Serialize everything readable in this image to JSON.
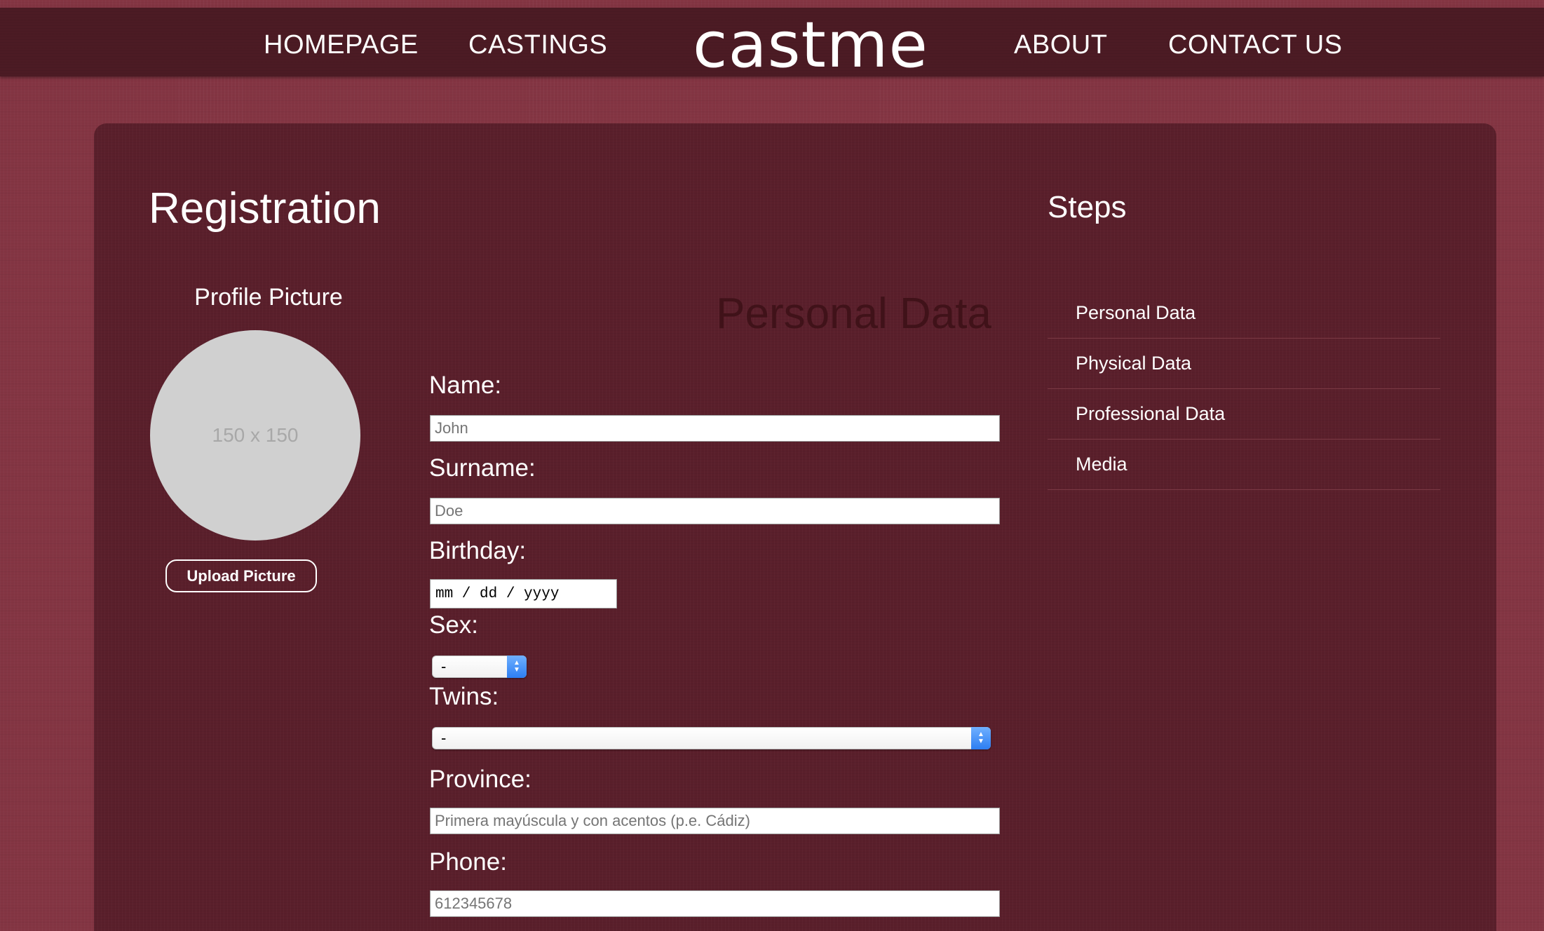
{
  "nav": {
    "links": [
      "HOMEPAGE",
      "CASTINGS",
      "ABOUT",
      "CONTACT US"
    ],
    "logo": "castme"
  },
  "page": {
    "title": "Registration"
  },
  "profile": {
    "title": "Profile Picture",
    "placeholder": "150 x 150",
    "upload_label": "Upload Picture"
  },
  "form": {
    "section_title": "Personal Data",
    "name": {
      "label": "Name:",
      "placeholder": "John"
    },
    "surname": {
      "label": "Surname:",
      "placeholder": "Doe"
    },
    "birthday": {
      "label": "Birthday:",
      "placeholder": "mm / dd / yyyy"
    },
    "sex": {
      "label": "Sex:",
      "value": "-"
    },
    "twins": {
      "label": "Twins:",
      "value": "-"
    },
    "province": {
      "label": "Province:",
      "placeholder": "Primera mayúscula y con acentos (p.e. Cádiz)"
    },
    "phone": {
      "label": "Phone:",
      "placeholder": "612345678"
    }
  },
  "steps": {
    "title": "Steps",
    "items": [
      "Personal Data",
      "Physical Data",
      "Professional Data",
      "Media"
    ]
  },
  "colors": {
    "background": "#843543",
    "nav": "#4c1b24",
    "panel": "#5a1f2b",
    "section_title": "#401219"
  }
}
